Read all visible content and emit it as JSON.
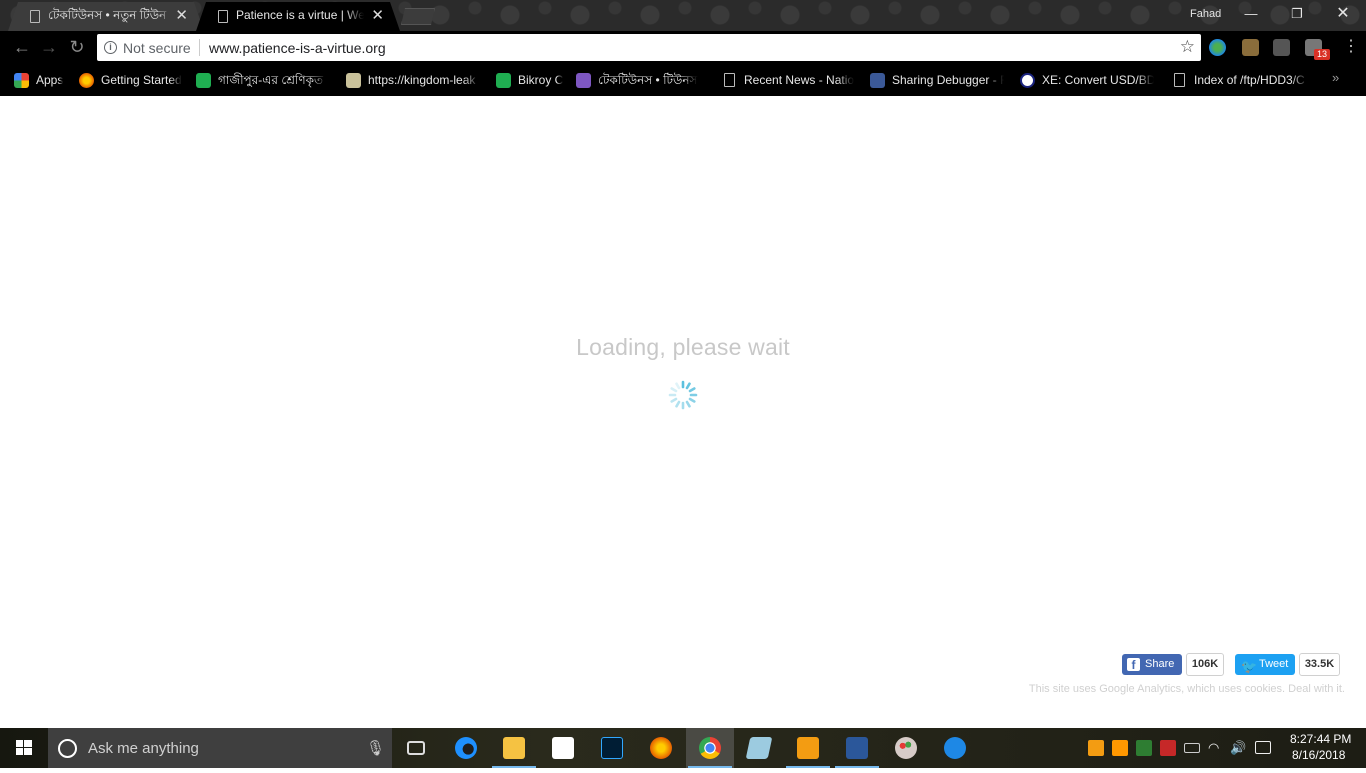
{
  "browser": {
    "tabs": [
      {
        "title": "টেকটিউনস • নতুন টিউন",
        "active": false
      },
      {
        "title": "Patience is a virtue | Welc",
        "active": true
      }
    ],
    "profile_name": "Fahad",
    "security_label": "Not secure",
    "url": "www.patience-is-a-virtue.org",
    "extension_badge": "13",
    "bookmarks": [
      {
        "label": "Apps",
        "icon": "apps-grid-icon"
      },
      {
        "label": "Getting Started",
        "icon": "firefox-icon"
      },
      {
        "label": "গাজীপুর-এর শ্রেণিকৃত",
        "icon": "bikroy-icon"
      },
      {
        "label": "https://kingdom-leak",
        "icon": "castle-icon"
      },
      {
        "label": "Bikroy C",
        "icon": "bikroy-icon"
      },
      {
        "label": "টেকটিউনস • টিউনস",
        "icon": "techtunes-icon"
      },
      {
        "label": "Recent News - Natior",
        "icon": "page-icon"
      },
      {
        "label": "Sharing Debugger - F",
        "icon": "facebook-icon"
      },
      {
        "label": "XE: Convert USD/BDT",
        "icon": "xe-icon"
      },
      {
        "label": "Index of /ftp/HDD3/C",
        "icon": "page-icon"
      }
    ]
  },
  "page": {
    "loading_text": "Loading, please wait",
    "share_label": "Share",
    "share_count": "106K",
    "tweet_label": "Tweet",
    "tweet_count": "33.5K",
    "cookie_note": "This site uses Google Analytics, which uses cookies. Deal with it."
  },
  "taskbar": {
    "search_placeholder": "Ask me anything",
    "clock_time": "8:27:44 PM",
    "clock_date": "8/16/2018",
    "apps": [
      "task-view",
      "edge",
      "file-explorer",
      "store",
      "photoshop",
      "firefox",
      "chrome",
      "notes",
      "media-player",
      "word",
      "paint",
      "vpn"
    ]
  },
  "colors": {
    "facebook": "#4267b2",
    "twitter": "#1da1f2",
    "spinner": "#5bc0de"
  }
}
